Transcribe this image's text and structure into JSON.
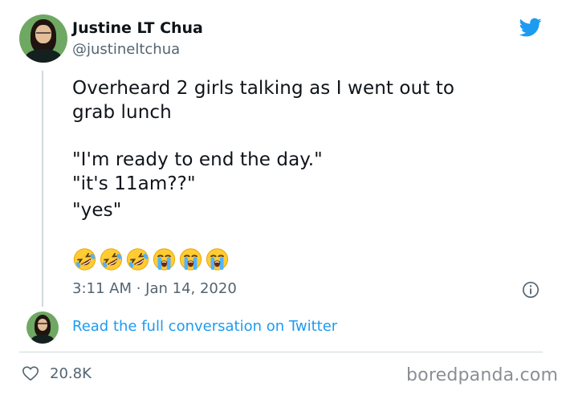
{
  "author": {
    "display_name": "Justine LT Chua",
    "handle": "@justineltchua"
  },
  "tweet": {
    "lines": [
      "Overheard 2 girls talking as I went out to",
      "grab lunch",
      "\"I'm ready to end the day.\"",
      "\"it's 11am??\"",
      "\"yes\""
    ],
    "emojis": [
      "rolling-laughing",
      "rolling-laughing",
      "rolling-laughing",
      "loudly-crying",
      "loudly-crying",
      "loudly-crying"
    ],
    "timestamp": "3:11 AM · Jan 14, 2020"
  },
  "conversation_link": "Read the full conversation on Twitter",
  "likes": "20.8K",
  "watermark": "boredpanda.com",
  "colors": {
    "twitter_blue": "#1d9bf0",
    "secondary_text": "#536471",
    "divider": "#cfd9de"
  },
  "icons": [
    "twitter-bird-icon",
    "info-icon",
    "heart-icon"
  ]
}
